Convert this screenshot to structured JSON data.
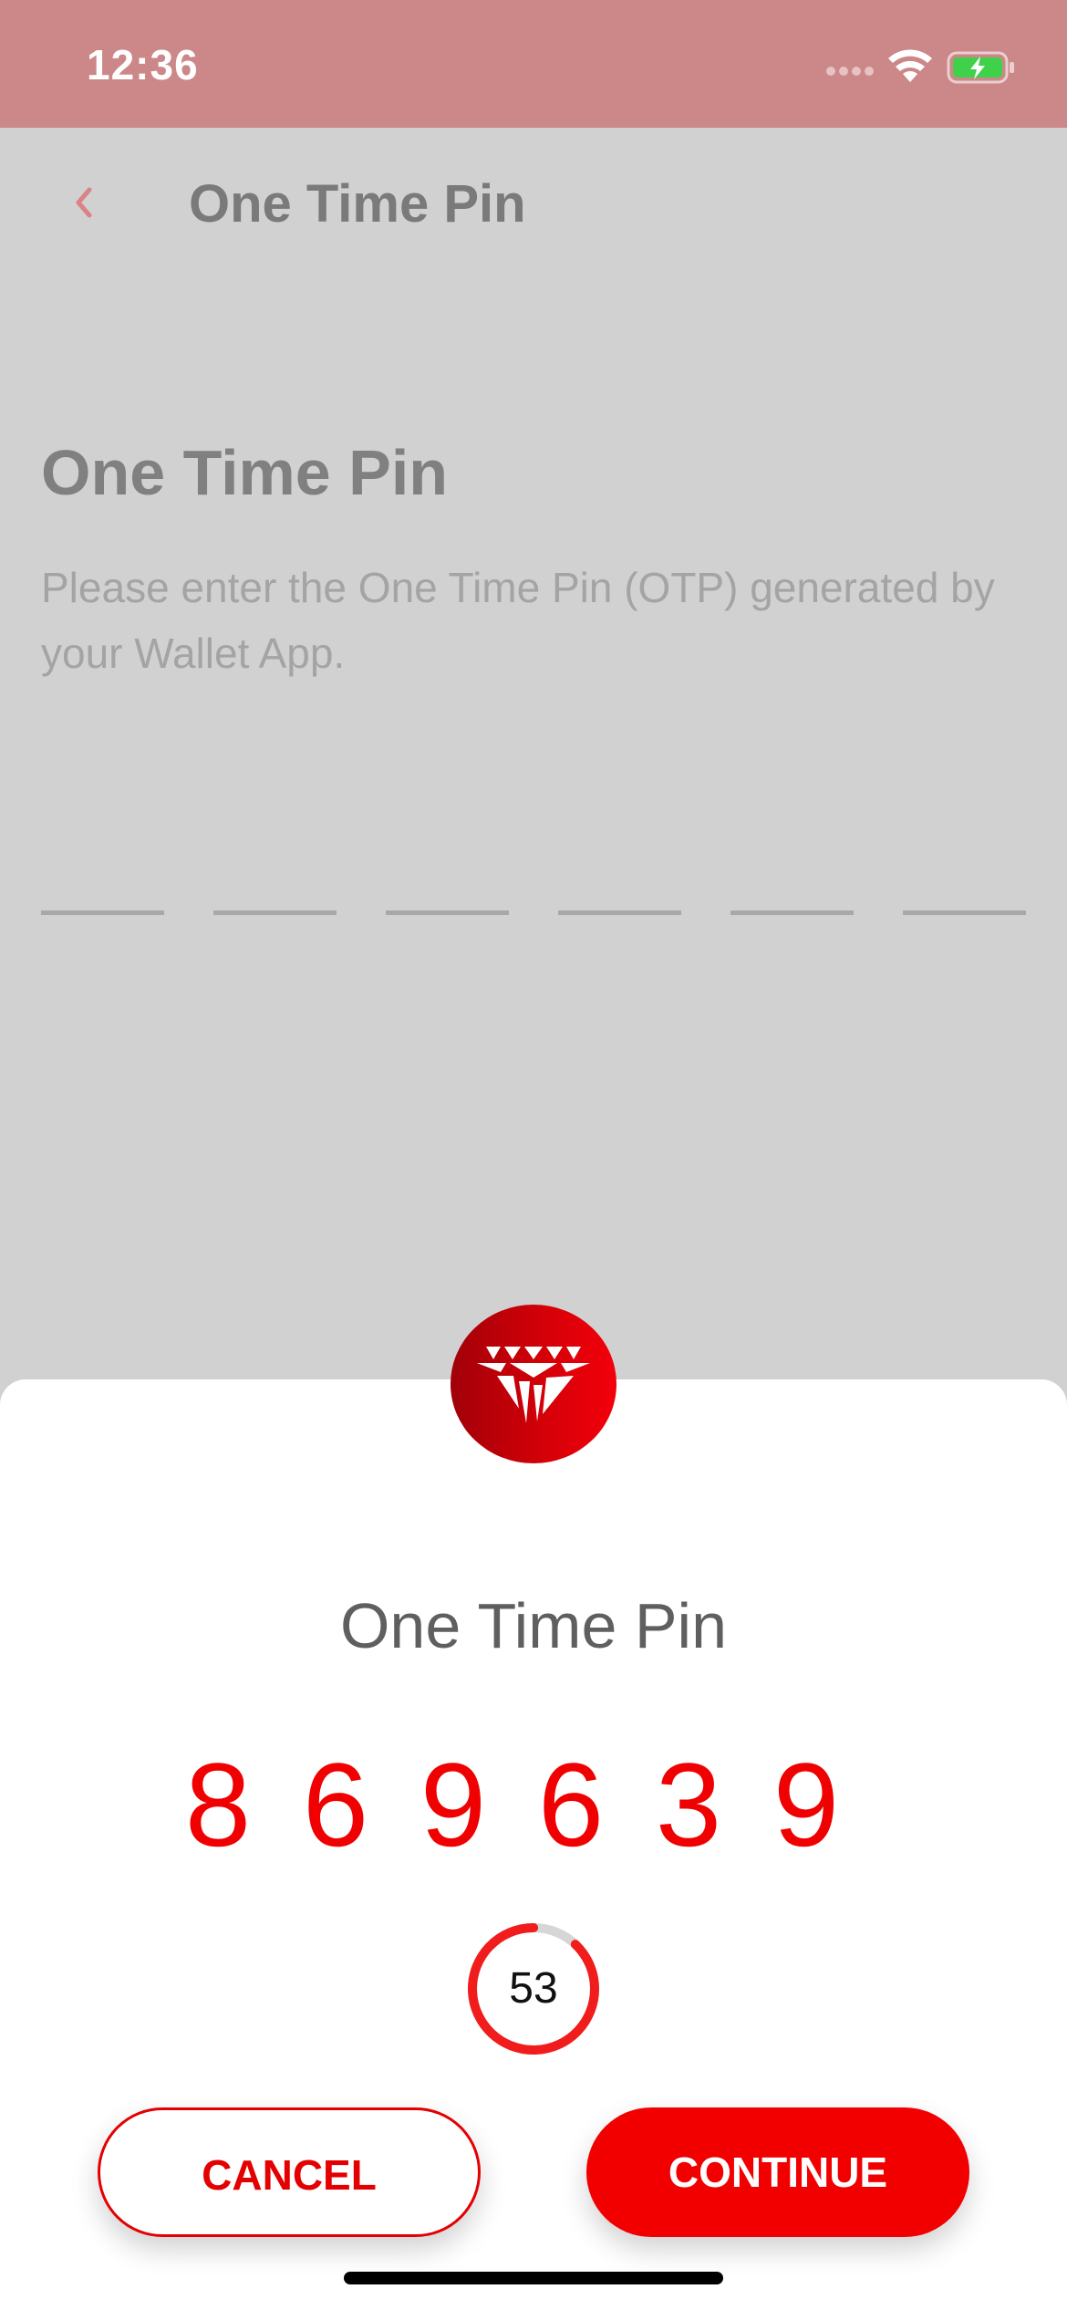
{
  "status_bar": {
    "time": "12:36",
    "icons": [
      "cellular-signal-icon",
      "wifi-icon",
      "battery-charging-icon"
    ]
  },
  "nav": {
    "back_icon": "chevron-left-icon",
    "title": "One Time Pin"
  },
  "page": {
    "heading": "One Time Pin",
    "description": "Please enter the One Time Pin (OTP) generated by your Wallet App.",
    "otp_slot_count": 6
  },
  "sheet": {
    "logo_icon": "diamond-logo-icon",
    "title": "One Time Pin",
    "otp_digits": [
      "8",
      "6",
      "9",
      "6",
      "3",
      "9"
    ],
    "countdown": {
      "seconds": "53",
      "fraction_remaining": 0.88
    },
    "buttons": {
      "cancel": "CANCEL",
      "continue": "CONTINUE"
    }
  },
  "colors": {
    "accent": "#f20000",
    "status_bar": "#cc8788",
    "overlay_background": "#d1d1d1"
  }
}
